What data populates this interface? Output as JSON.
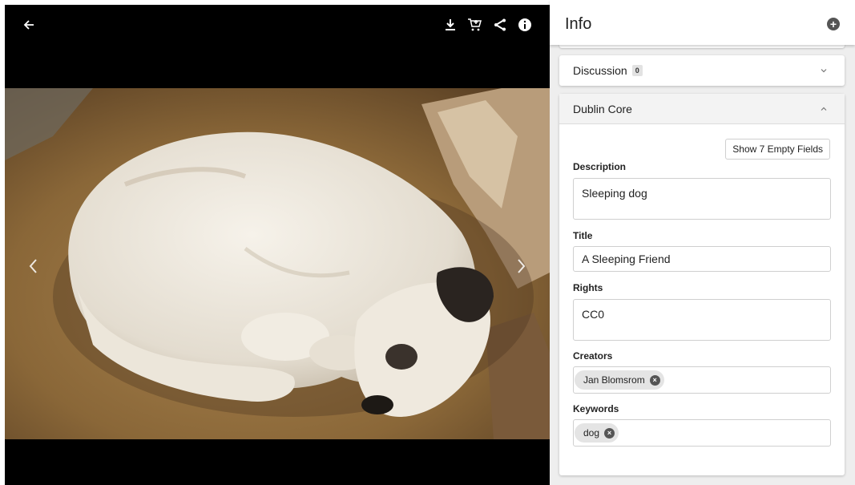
{
  "viewer": {
    "icons": {
      "back": "arrow-left-icon",
      "download": "download-icon",
      "cart": "add-to-cart-icon",
      "share": "share-icon",
      "info": "info-icon",
      "prev": "chevron-left-icon",
      "next": "chevron-right-icon"
    }
  },
  "panel": {
    "title": "Info",
    "discussion": {
      "label": "Discussion",
      "count": "0"
    },
    "dublin_core": {
      "label": "Dublin Core",
      "empty_fields_button": "Show 7 Empty Fields",
      "fields": {
        "description": {
          "label": "Description",
          "value": "Sleeping dog"
        },
        "title": {
          "label": "Title",
          "value": "A Sleeping Friend"
        },
        "rights": {
          "label": "Rights",
          "value": "CC0"
        },
        "creators": {
          "label": "Creators",
          "chips": [
            "Jan Blomsrom"
          ]
        },
        "keywords": {
          "label": "Keywords",
          "chips": [
            "dog"
          ]
        }
      }
    }
  },
  "colors": {
    "panel_bg": "#eeeeee",
    "viewer_bg": "#000000"
  }
}
